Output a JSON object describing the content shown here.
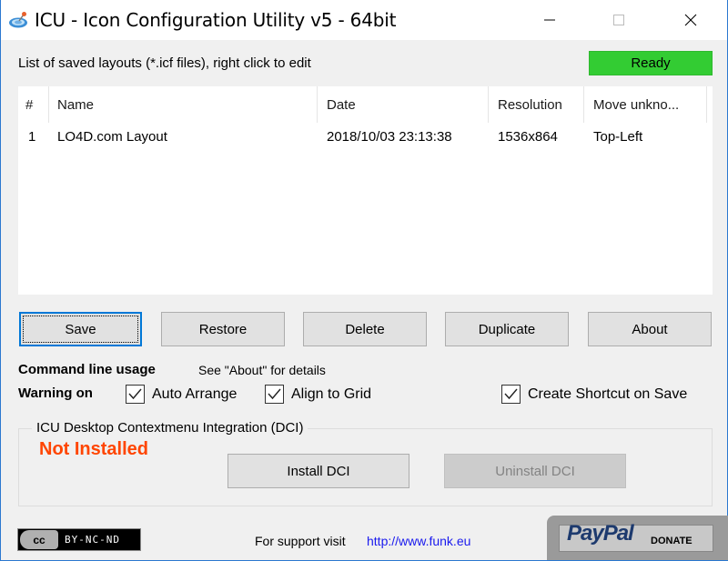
{
  "window": {
    "title": "ICU - Icon Configuration Utility v5 - 64bit",
    "app_icon": "icu-app-icon",
    "controls": [
      "minimize-icon",
      "maximize-icon",
      "close-icon"
    ]
  },
  "header": {
    "list_label": "List of saved layouts (*.icf files), right click to edit",
    "status": "Ready",
    "status_color": "#33cc33"
  },
  "layouts_table": {
    "columns": [
      "#",
      "Name",
      "Date",
      "Resolution",
      "Move unkno..."
    ],
    "rows": [
      {
        "num": "1",
        "name": "LO4D.com Layout",
        "date": "2018/10/03 23:13:38",
        "resolution": "1536x864",
        "move_unknown": "Top-Left"
      }
    ]
  },
  "buttons": {
    "save": "Save",
    "restore": "Restore",
    "delete": "Delete",
    "duplicate": "Duplicate",
    "about": "About"
  },
  "command_line": {
    "label": "Command line usage",
    "value": "See \"About\" for details"
  },
  "warning": {
    "label": "Warning on",
    "options": [
      {
        "label": "Auto Arrange",
        "checked": true
      },
      {
        "label": "Align to Grid",
        "checked": true
      }
    ]
  },
  "create_shortcut": {
    "label": "Create Shortcut on Save",
    "checked": true
  },
  "dci": {
    "title": "ICU Desktop Contextmenu Integration (DCI)",
    "status": "Not Installed",
    "status_color": "#ff4500",
    "install_label": "Install DCI",
    "uninstall_label": "Uninstall DCI",
    "uninstall_enabled": false
  },
  "footer": {
    "license_cc": "cc",
    "license_text": "BY-NC-ND",
    "support_text": "For support visit",
    "support_link": "http://www.funk.eu",
    "paypal_logo": "PayPal",
    "paypal_donate": "DONATE"
  }
}
